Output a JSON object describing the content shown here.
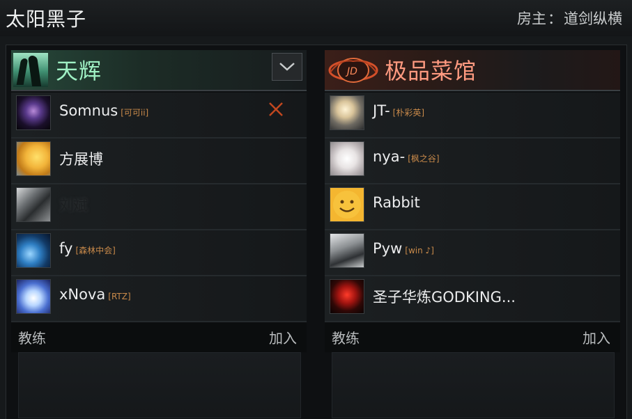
{
  "lobby": {
    "title": "太阳黑子",
    "host_label": "房主",
    "host_sep": "：",
    "host_name": "道剑纵横"
  },
  "teams": {
    "radiant": {
      "name": "天辉",
      "coach_label": "教练",
      "join_label": "加入",
      "players": [
        {
          "name": "Somnus",
          "tag": "[可可ii]"
        },
        {
          "name": "方展博",
          "tag": ""
        },
        {
          "name": "刘斌",
          "tag": ""
        },
        {
          "name": "fy",
          "tag": "[森林中会]"
        },
        {
          "name": "xNova",
          "tag": "[RTZ]"
        }
      ]
    },
    "dire": {
      "name": "极品菜馆",
      "coach_label": "教练",
      "join_label": "加入",
      "players": [
        {
          "name": "JT-",
          "tag": "[朴彩英]"
        },
        {
          "name": "nya-",
          "tag": "[枫之谷]"
        },
        {
          "name": "Rabbit",
          "tag": ""
        },
        {
          "name": "Pyw",
          "tag": "[win ♪]"
        },
        {
          "name": "圣子华炼GODKING...",
          "tag": ""
        }
      ]
    }
  },
  "colors": {
    "radiant_accent": "#9ff0c4",
    "dire_accent": "#ff9a80",
    "kick": "#c1471f",
    "tag": "#c98a4a"
  },
  "icons": {
    "collapse": "chevron-down-icon",
    "kick": "close-icon"
  }
}
